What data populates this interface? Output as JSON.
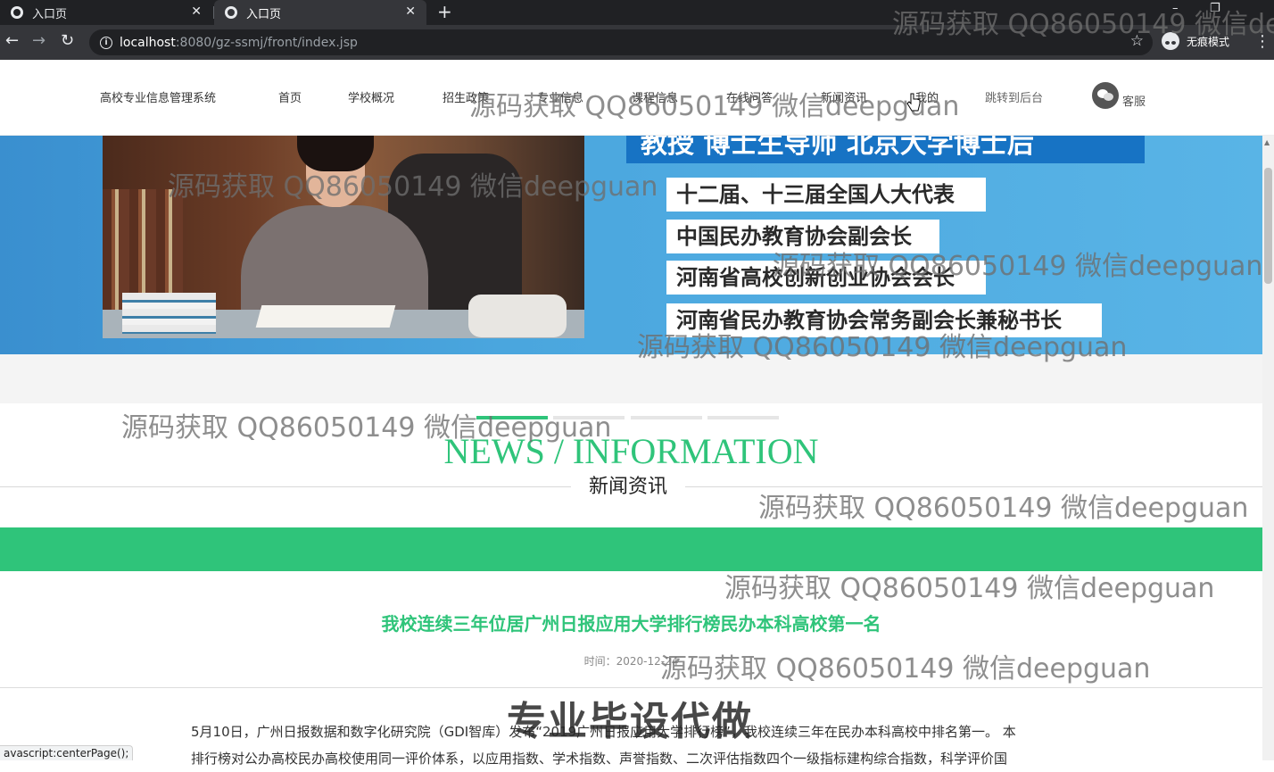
{
  "browser": {
    "tabs": [
      {
        "label": "入口页",
        "active": false
      },
      {
        "label": "入口页",
        "active": true
      }
    ],
    "new_tab_symbol": "+",
    "url_host": "localhost",
    "url_path": ":8080/gz-ssmj/front/index.jsp",
    "incognito_label": "无痕模式",
    "status_text": "avascript:centerPage();"
  },
  "site_nav": {
    "brand": "高校专业信息管理系统",
    "items": [
      "首页",
      "学校概况",
      "招生政策",
      "专业信息",
      "课程信息",
      "在线问答",
      "新闻资讯",
      "我的"
    ],
    "admin_link": "跳转到后台",
    "service_label": "客服"
  },
  "banner": {
    "title_line": "教授 博士生导师 北京大学博士后",
    "titles": [
      "十二届、十三届全国人大代表",
      "中国民办教育协会副会长",
      "河南省高校创新创业协会会长",
      "河南省民办教育协会常务副会长兼秘书长"
    ],
    "slide_count": 4,
    "active_slide": 1
  },
  "news_section": {
    "heading_en": "NEWS / INFORMATION",
    "heading_cn": "新闻资讯"
  },
  "article": {
    "title": "我校连续三年位居广州日报应用大学排行榜民办本科高校第一名",
    "meta": "时间：2020-12-24",
    "body_lines": [
      "5月10日，广州日报数据和数字化研究院（GDI智库）发布“2019广州日报应用大学排行榜”，我校连续三年在民办本科高校中排名第一。 本",
      "排行榜对公办高校民办高校使用同一评价体系，以应用指数、学术指数、声誉指数、二次评估指数四个一级指标建构综合指数，科学评价国"
    ]
  },
  "watermarks": [
    "源码获取 QQ86050149 微信deepguan",
    "源码获取 QQ86050149 微信de"
  ],
  "promo_text": "专业毕设代做",
  "colors": {
    "accent_green": "#2fc47a",
    "banner_blue": "#4aa6de",
    "chrome_dark": "#202124"
  }
}
